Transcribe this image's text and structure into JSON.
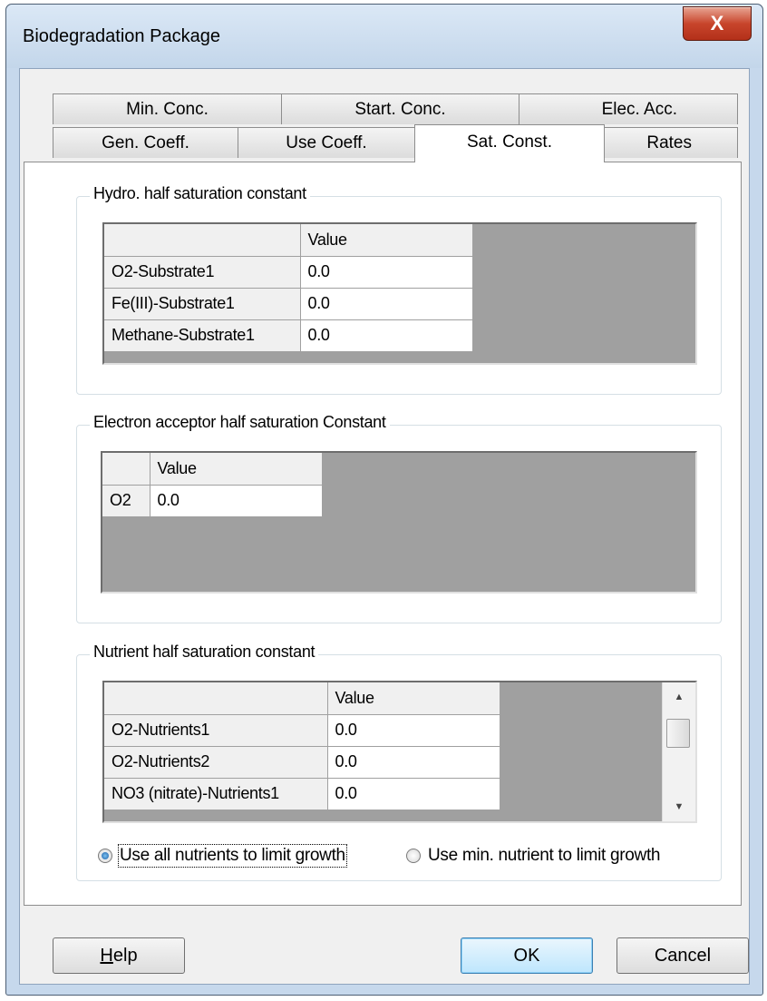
{
  "window": {
    "title": "Biodegradation Package",
    "close_label": "X"
  },
  "tabs": {
    "row1": [
      {
        "label": "Min. Conc."
      },
      {
        "label": "Start. Conc."
      },
      {
        "label": "Elec. Acc."
      }
    ],
    "row2": [
      {
        "label": "Gen. Coeff."
      },
      {
        "label": "Use Coeff."
      },
      {
        "label": "Sat. Const.",
        "active": true
      },
      {
        "label": "Rates"
      }
    ]
  },
  "hydro_group": {
    "label": "Hydro. half saturation constant",
    "column_header": "Value",
    "rows": [
      {
        "name": "O2-Substrate1",
        "value": "0.0"
      },
      {
        "name": "Fe(III)-Substrate1",
        "value": "0.0"
      },
      {
        "name": "Methane-Substrate1",
        "value": "0.0"
      }
    ]
  },
  "electron_group": {
    "label": "Electron acceptor half saturation Constant",
    "column_header": "Value",
    "rows": [
      {
        "name": "O2",
        "value": "0.0"
      }
    ]
  },
  "nutrient_group": {
    "label": "Nutrient half saturation constant",
    "column_header": "Value",
    "rows": [
      {
        "name": "O2-Nutrients1",
        "value": "0.0"
      },
      {
        "name": "O2-Nutrients2",
        "value": "0.0"
      },
      {
        "name": "NO3 (nitrate)-Nutrients1",
        "value": "0.0"
      }
    ],
    "scroll_up": "▲",
    "scroll_down": "▼"
  },
  "options": {
    "all_nutrients": "Use all nutrients to limit growth",
    "min_nutrient": "Use min. nutrient to limit growth",
    "selected": "all_nutrients"
  },
  "buttons": {
    "help_mnemonic": "H",
    "help_rest": "elp",
    "ok": "OK",
    "cancel": "Cancel"
  },
  "colors": {
    "accent": "#3c7fb1",
    "close_button": "#c8452c",
    "grid_empty": "#a0a0a0"
  }
}
